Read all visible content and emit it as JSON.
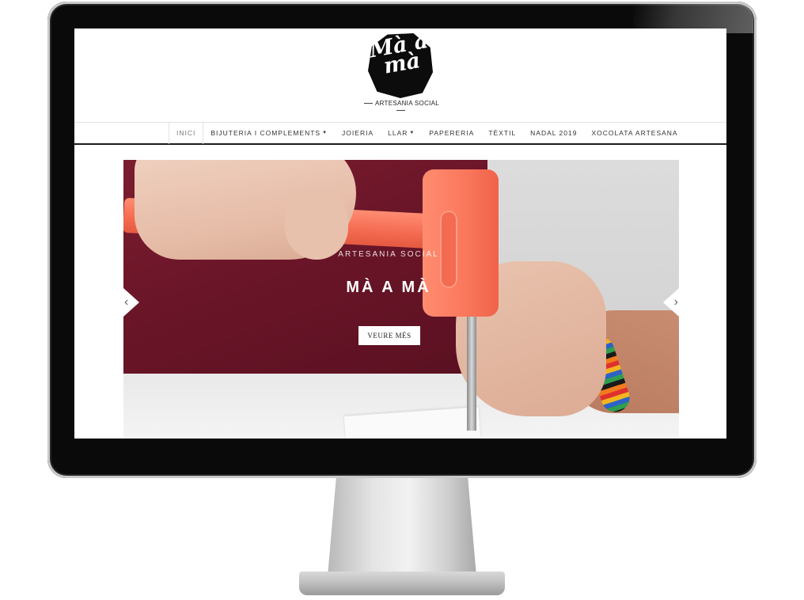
{
  "logo": {
    "mark_text": "Mà a mà",
    "tagline": "ARTESANIA SOCIAL"
  },
  "nav": {
    "items": [
      {
        "label": "INICI",
        "active": true,
        "dropdown": false
      },
      {
        "label": "BIJUTERIA I COMPLEMENTS",
        "active": false,
        "dropdown": true
      },
      {
        "label": "JOIERIA",
        "active": false,
        "dropdown": false
      },
      {
        "label": "LLAR",
        "active": false,
        "dropdown": true
      },
      {
        "label": "PAPERERIA",
        "active": false,
        "dropdown": false
      },
      {
        "label": "TÈXTIL",
        "active": false,
        "dropdown": false
      },
      {
        "label": "NADAL 2019",
        "active": false,
        "dropdown": false
      },
      {
        "label": "XOCOLATA ARTESANA",
        "active": false,
        "dropdown": false
      }
    ],
    "dropdown_icon": "caret-down-icon"
  },
  "hero": {
    "kicker": "ARTESANIA SOCIAL",
    "title": "MÀ A MÀ",
    "button_label": "VEURE MÉS",
    "prev_icon": "chevron-left-icon",
    "next_icon": "chevron-right-icon",
    "image": "hands-hammering-leather-photo"
  },
  "colors": {
    "accent_hammer": "#f36a50",
    "cloth": "#6a1528",
    "bezel": "#0a0a0a",
    "text": "#333333"
  }
}
